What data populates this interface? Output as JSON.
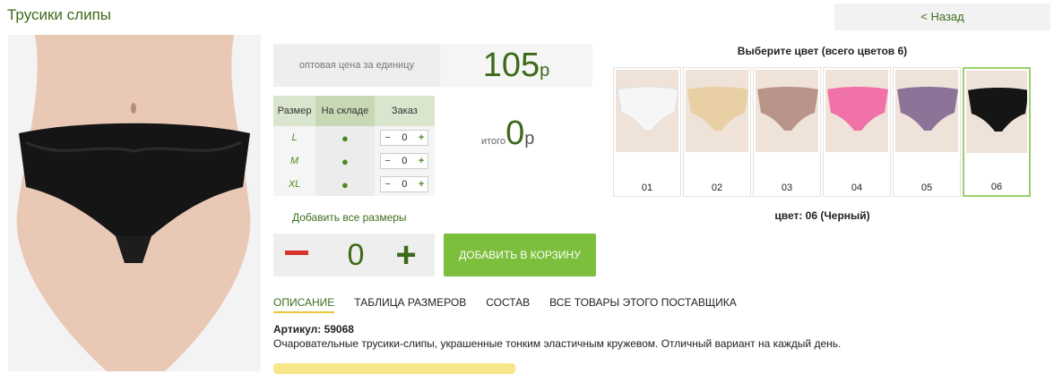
{
  "page": {
    "title": "Трусики слипы",
    "back_label": "< Назад"
  },
  "price": {
    "label": "оптовая цена за единицу",
    "value": "105",
    "currency": "р"
  },
  "sizes_table": {
    "headers": [
      "Размер",
      "На складе",
      "Заказ"
    ],
    "rows": [
      {
        "size": "L",
        "in_stock": "●",
        "qty": "0"
      },
      {
        "size": "M",
        "in_stock": "●",
        "qty": "0"
      },
      {
        "size": "XL",
        "in_stock": "●",
        "qty": "0"
      }
    ],
    "stepper_minus": "−",
    "stepper_plus": "+"
  },
  "total": {
    "label": "итого",
    "value": "0",
    "currency": "р"
  },
  "add_all_sizes": "Добавить все размеры",
  "qty_stepper": {
    "value": "0",
    "minus": "−",
    "plus": "+"
  },
  "add_to_cart": "ДОБАВИТЬ В КОРЗИНУ",
  "colors": {
    "header": "Выберите цвет (всего цветов 6)",
    "swatches": [
      {
        "num": "01",
        "hex": "#f6f6f6"
      },
      {
        "num": "02",
        "hex": "#e8cfa4"
      },
      {
        "num": "03",
        "hex": "#b9948a"
      },
      {
        "num": "04",
        "hex": "#f072a8"
      },
      {
        "num": "05",
        "hex": "#8c7398"
      },
      {
        "num": "06",
        "hex": "#151515"
      }
    ],
    "selected_caption": "цвет: 06 (Черный)"
  },
  "tabs": [
    "ОПИСАНИЕ",
    "ТАБЛИЦА РАЗМЕРОВ",
    "СОСТАВ",
    "ВСЕ ТОВАРЫ ЭТОГО ПОСТАВЩИКА"
  ],
  "article": "Артикул: 59068",
  "description": "Очаровательные трусики-слипы, украшенные тонким эластичным кружевом. Отличный вариант на каждый день.",
  "theme": {
    "accent": "#3c6a1b",
    "button_green": "#7cbf3c",
    "minus_red": "#d9322a",
    "selected_border": "#9bcf6a"
  }
}
